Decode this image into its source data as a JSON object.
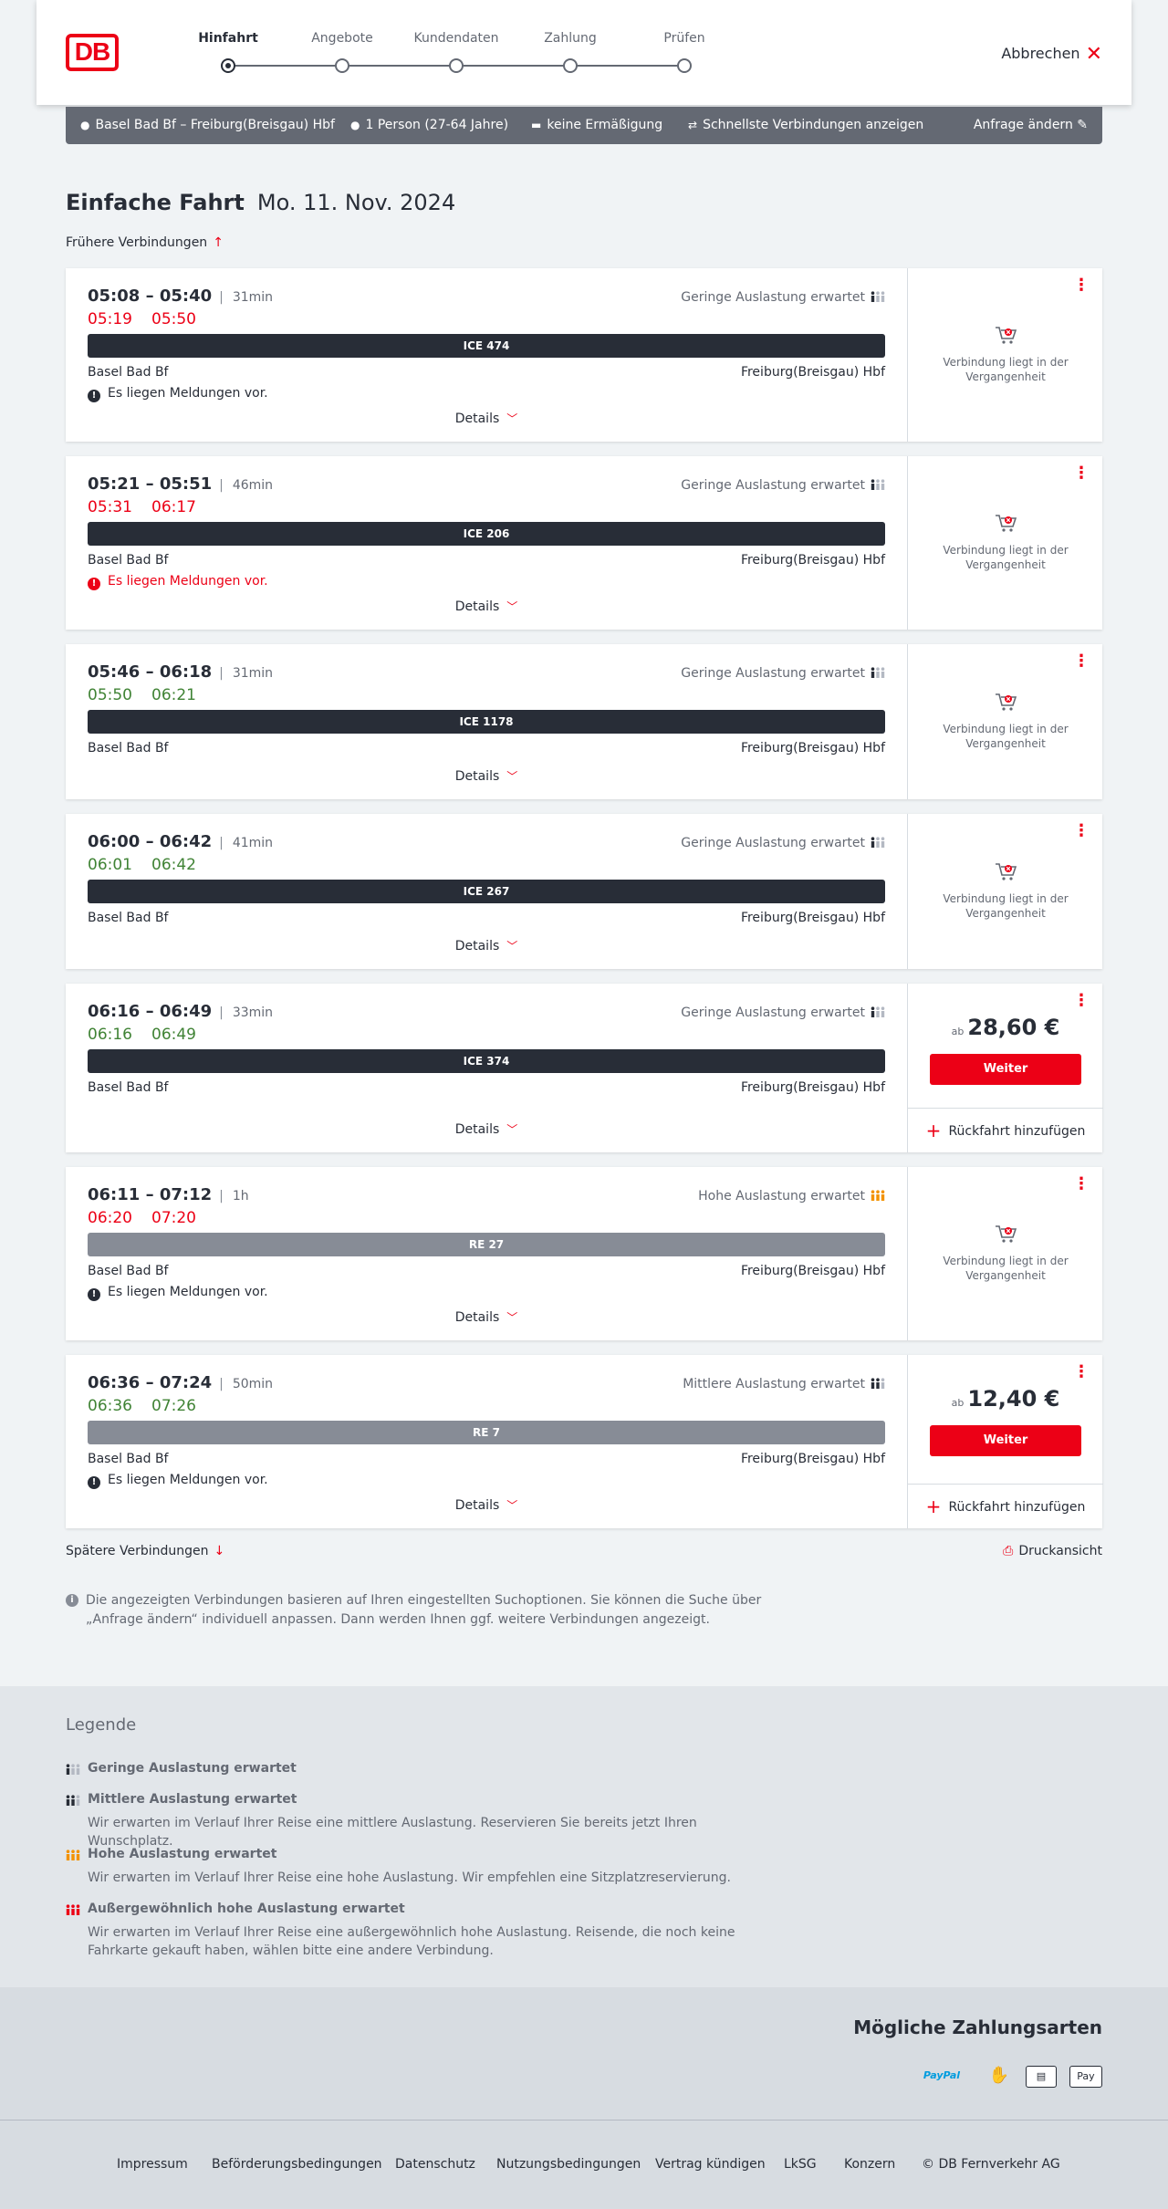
{
  "header": {
    "logo": "DB",
    "steps": [
      "Hinfahrt",
      "Angebote",
      "Kundendaten",
      "Zahlung",
      "Prüfen"
    ],
    "cancel_label": "Abbrechen"
  },
  "query": {
    "route": "Basel Bad Bf – Freiburg(Breisgau) Hbf",
    "travellers": "1 Person (27-64 Jahre)",
    "discount": "keine Ermäßigung",
    "option": "Schnellste Verbindungen anzeigen",
    "change_label": "Anfrage ändern"
  },
  "title": {
    "trip_type": "Einfache Fahrt",
    "date": "Mo. 11. Nov. 2024"
  },
  "earlier_label": "Frühere Verbindungen",
  "later_label": "Spätere Verbindungen",
  "print_label": "Druckansicht",
  "details_label": "Details",
  "past_label": "Verbindung liegt in der Vergangenheit",
  "weiter_label": "Weiter",
  "return_label": "Rückfahrt hinzufügen",
  "price_prefix": "ab",
  "connections": [
    {
      "times": "05:08 – 05:40",
      "duration": "31min",
      "rt_dep": "05:19",
      "rt_arr": "05:50",
      "rt_status": "late",
      "load": "Geringe Auslastung erwartet",
      "load_level": "low",
      "train": "ICE 474",
      "train_type": "ice",
      "from": "Basel Bad Bf",
      "to": "Freiburg(Breisgau) Hbf",
      "message": "Es liegen Meldungen vor.",
      "message_type": "info",
      "bookable": false
    },
    {
      "times": "05:21 – 05:51",
      "duration": "46min",
      "rt_dep": "05:31",
      "rt_arr": "06:17",
      "rt_status": "late",
      "load": "Geringe Auslastung erwartet",
      "load_level": "low",
      "train": "ICE 206",
      "train_type": "ice",
      "from": "Basel Bad Bf",
      "to": "Freiburg(Breisgau) Hbf",
      "message": "Es liegen Meldungen vor.",
      "message_type": "warn",
      "bookable": false
    },
    {
      "times": "05:46 – 06:18",
      "duration": "31min",
      "rt_dep": "05:50",
      "rt_arr": "06:21",
      "rt_status": "ok",
      "load": "Geringe Auslastung erwartet",
      "load_level": "low",
      "train": "ICE 1178",
      "train_type": "ice",
      "from": "Basel Bad Bf",
      "to": "Freiburg(Breisgau) Hbf",
      "message": "",
      "message_type": "",
      "bookable": false
    },
    {
      "times": "06:00 – 06:42",
      "duration": "41min",
      "rt_dep": "06:01",
      "rt_arr": "06:42",
      "rt_status": "ok",
      "load": "Geringe Auslastung erwartet",
      "load_level": "low",
      "train": "ICE 267",
      "train_type": "ice",
      "from": "Basel Bad Bf",
      "to": "Freiburg(Breisgau) Hbf",
      "message": "",
      "message_type": "",
      "bookable": false
    },
    {
      "times": "06:16 – 06:49",
      "duration": "33min",
      "rt_dep": "06:16",
      "rt_arr": "06:49",
      "rt_status": "ok",
      "load": "Geringe Auslastung erwartet",
      "load_level": "low",
      "train": "ICE 374",
      "train_type": "ice",
      "from": "Basel Bad Bf",
      "to": "Freiburg(Breisgau) Hbf",
      "message": "",
      "message_type": "",
      "bookable": true,
      "price": "28,60 €"
    },
    {
      "times": "06:11 – 07:12",
      "duration": "1h",
      "rt_dep": "06:20",
      "rt_arr": "07:20",
      "rt_status": "late",
      "load": "Hohe Auslastung erwartet",
      "load_level": "high",
      "train": "RE 27",
      "train_type": "re",
      "from": "Basel Bad Bf",
      "to": "Freiburg(Breisgau) Hbf",
      "message": "Es liegen Meldungen vor.",
      "message_type": "info",
      "bookable": false
    },
    {
      "times": "06:36 – 07:24",
      "duration": "50min",
      "rt_dep": "06:36",
      "rt_arr": "07:26",
      "rt_status": "ok",
      "load": "Mittlere Auslastung erwartet",
      "load_level": "medium",
      "train": "RE 7",
      "train_type": "re",
      "from": "Basel Bad Bf",
      "to": "Freiburg(Breisgau) Hbf",
      "message": "Es liegen Meldungen vor.",
      "message_type": "info",
      "bookable": true,
      "price": "12,40 €"
    }
  ],
  "note": "Die angezeigten Verbindungen basieren auf Ihren eingestellten Suchoptionen. Sie können die Suche über „Anfrage ändern“ individuell anpassen. Dann werden Ihnen ggf. weitere Verbindungen angezeigt.",
  "legend": {
    "title": "Legende",
    "items": [
      {
        "label": "Geringe Auslastung erwartet",
        "desc": "",
        "level": "low"
      },
      {
        "label": "Mittlere Auslastung erwartet",
        "desc": "Wir erwarten im Verlauf Ihrer Reise eine mittlere Auslastung. Reservieren Sie bereits jetzt Ihren Wunschplatz.",
        "level": "medium"
      },
      {
        "label": "Hohe Auslastung erwartet",
        "desc": "Wir erwarten im Verlauf Ihrer Reise eine hohe Auslastung. Wir empfehlen eine Sitzplatzreservierung.",
        "level": "high"
      },
      {
        "label": "Außergewöhnlich hohe Auslastung erwartet",
        "desc": "Wir erwarten im Verlauf Ihrer Reise eine außergewöhnlich hohe Auslastung. Reisende, die noch keine Fahrkarte gekauft haben, wählen bitte eine andere Verbindung.",
        "level": "extreme"
      }
    ]
  },
  "payment": {
    "title": "Mögliche Zahlungsarten",
    "methods": [
      "PayPal",
      "card-contactless-icon",
      "sepa-icon",
      "Pay"
    ]
  },
  "footer": {
    "links": [
      "Impressum",
      "Beförderungsbedingungen",
      "Datenschutz",
      "Nutzungsbedingungen",
      "Vertrag kündigen",
      "LkSG",
      "Konzern",
      "© DB Fernverkehr AG"
    ]
  },
  "colors": {
    "accent": "#ec0016",
    "late": "#ec0016",
    "on_time": "#408335",
    "dark": "#282d37",
    "high_load": "#f39200"
  }
}
